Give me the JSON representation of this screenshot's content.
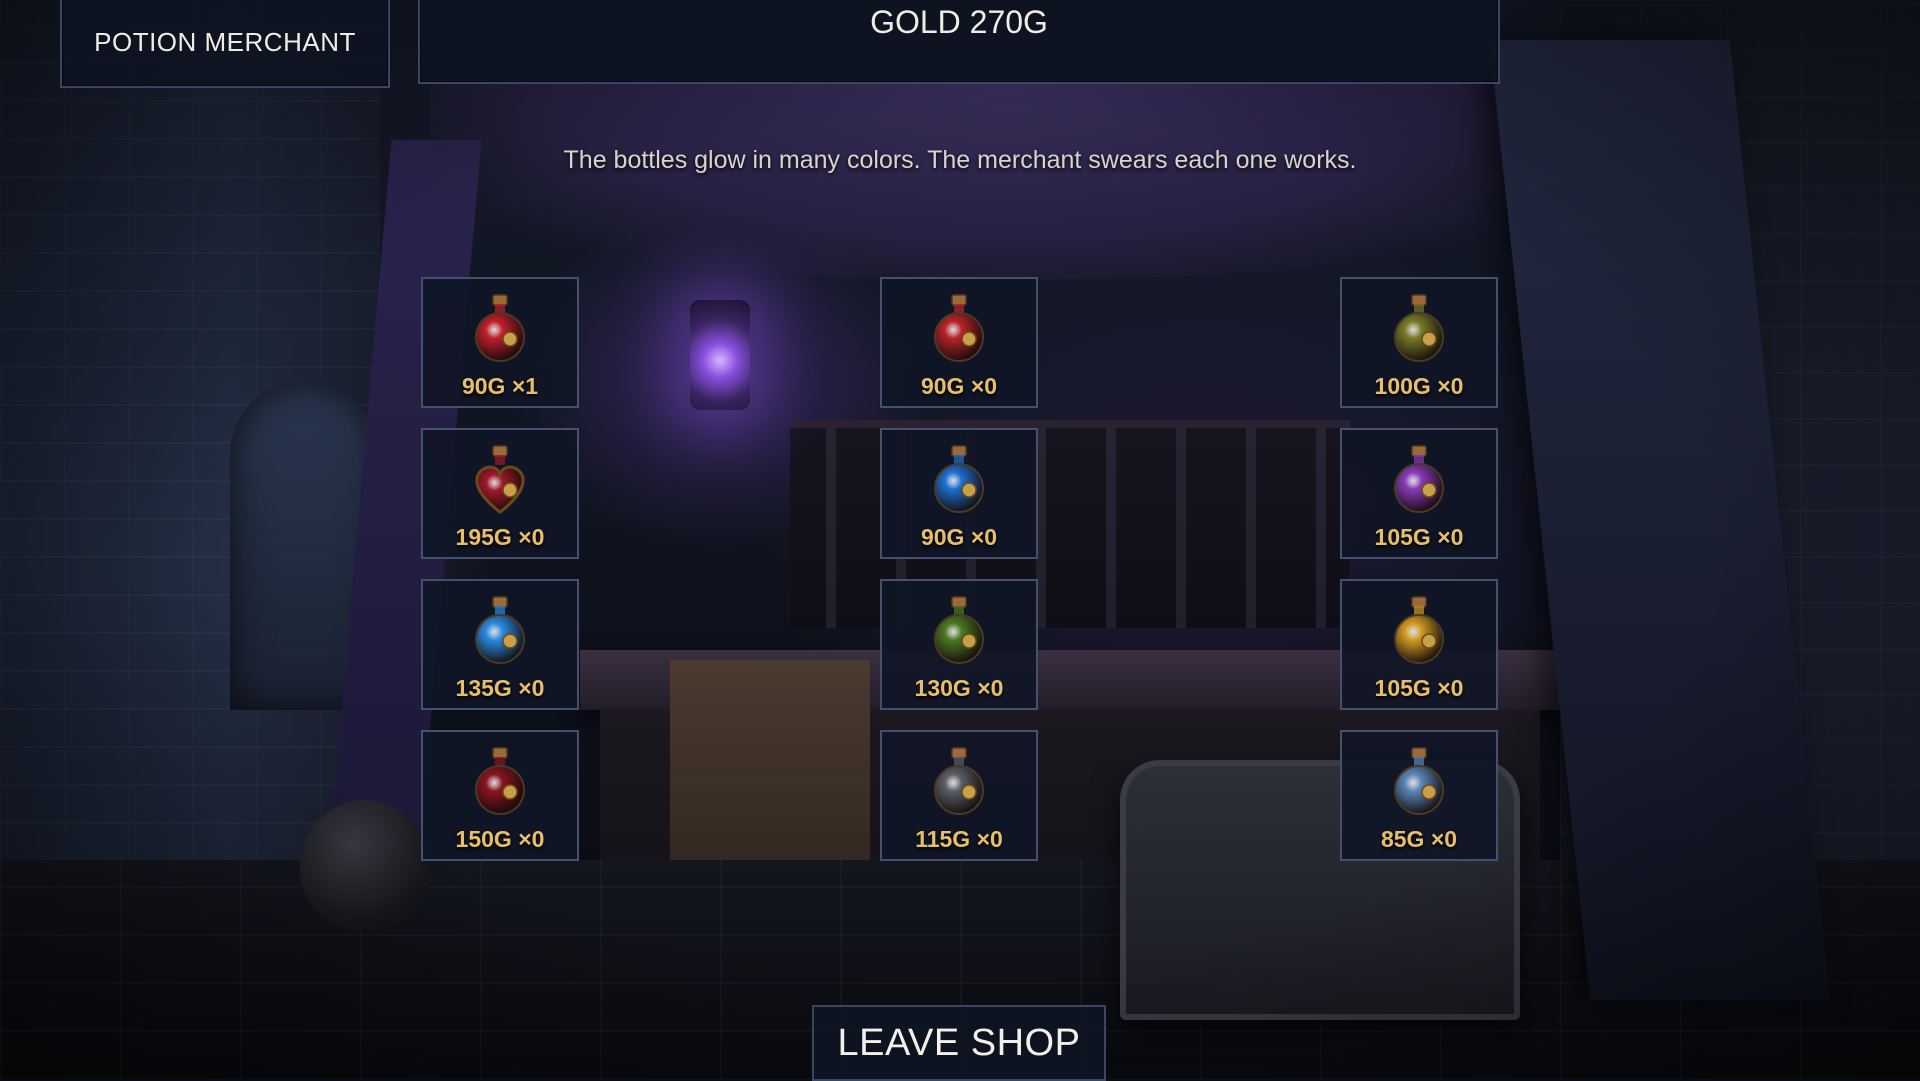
{
  "header": {
    "shop_title": "POTION MERCHANT",
    "gold_text": "GOLD 270G"
  },
  "flavor_text": "The bottles glow in many colors. The merchant swears each one works.",
  "items": [
    {
      "label": "90G ×1",
      "price": 90,
      "qty": 1,
      "icon": "red-health-potion-icon",
      "color": "#c0202a"
    },
    {
      "label": "90G ×0",
      "price": 90,
      "qty": 0,
      "icon": "red-shield-potion-icon",
      "color": "#b8242a"
    },
    {
      "label": "100G ×0",
      "price": 100,
      "qty": 0,
      "icon": "olive-skull-potion-icon",
      "color": "#7a7a2a"
    },
    {
      "label": "195G ×0",
      "price": 195,
      "qty": 0,
      "icon": "heart-potion-icon",
      "color": "#a0182a"
    },
    {
      "label": "90G ×0",
      "price": 90,
      "qty": 0,
      "icon": "blue-shield-potion-icon",
      "color": "#1e6fd0"
    },
    {
      "label": "105G ×0",
      "price": 105,
      "qty": 0,
      "icon": "purple-cross-potion-icon",
      "color": "#8a3ab8"
    },
    {
      "label": "135G ×0",
      "price": 135,
      "qty": 0,
      "icon": "swirl-potion-icon",
      "color": "#2a8ae0"
    },
    {
      "label": "130G ×0",
      "price": 130,
      "qty": 0,
      "icon": "green-clover-potion-icon",
      "color": "#4a7a22"
    },
    {
      "label": "105G ×0",
      "price": 105,
      "qty": 0,
      "icon": "gold-star-potion-icon",
      "color": "#d09a22"
    },
    {
      "label": "150G ×0",
      "price": 150,
      "qty": 0,
      "icon": "dark-red-potion-icon",
      "color": "#8a1420"
    },
    {
      "label": "115G ×0",
      "price": 115,
      "qty": 0,
      "icon": "iron-shield-potion-icon",
      "color": "#5a5e66"
    },
    {
      "label": "85G ×0",
      "price": 85,
      "qty": 0,
      "icon": "pale-blue-potion-icon",
      "color": "#5a86b8"
    }
  ],
  "leave_button": "LEAVE SHOP"
}
